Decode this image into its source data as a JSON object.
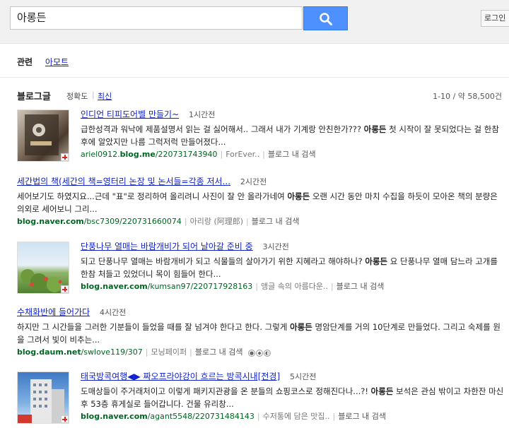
{
  "search": {
    "query": "아롱든",
    "login_label": "로그인"
  },
  "related": {
    "label": "관련",
    "items": [
      "아모트"
    ]
  },
  "section": {
    "title": "블로그글",
    "sort_accuracy": "정확도",
    "sort_latest": "최신",
    "count": "1-10 / 약 58,500건"
  },
  "results": [
    {
      "title": "인디언 티피도어벨 만들기~",
      "time": "1시간전",
      "snippet_pre": "급한성격과 워낙에 제품설명서 읽는 걸 싫어해서.. 그래서 내가 기계랑 안친한가??? ",
      "snippet_bold": "아롱든",
      "snippet_post": " 첫 시작이 잘 못되었다는 걸 한참 후에 알았지만 나름 그럭저럭 만들어졌다...",
      "url_pre": "ariel0912.",
      "url_bold": "blog.me",
      "url_post": "/220731743940",
      "author": "ForEver..",
      "action": "블로그 내 검색"
    },
    {
      "title": "세간법의 책(세간의 책=영터리 논장 및 논서들=각종 저서...",
      "time": "2시간전",
      "snippet_pre": "세어보기도 하였지요...근데 \"표\"로 정리하여 올리려니 사진이 잘 안 올라가네여 ",
      "snippet_bold": "아롱든",
      "snippet_post": "  오랜 시간 동안 마치 수집을 하듯이 모아온 책의 분량은 의외로 세어보니 그리...",
      "url_pre": "",
      "url_bold": "blog.naver.com",
      "url_post": "/bsc7309/220731660074",
      "author": "아리랑 (阿理郎)",
      "action": "블로그 내 검색"
    },
    {
      "title": "단풍나무 열매는 바람개비가 되어 날아갈 준비 중",
      "time": "3시간전",
      "snippet_pre": "되고 단풍나무 열매는 바람개비가 되고 식물들의 살아가기 위한 지혜라고 해야하나? ",
      "snippet_bold": "아롱든",
      "snippet_post": " 요 단풍나무 열매 담느라 고개를 한참 처들고 있었더니 목이 힘들어 한다...",
      "url_pre": "",
      "url_bold": "blog.naver.com",
      "url_post": "/kumsan97/220717928163",
      "author": "앵글 속의 아름다운..",
      "action": "블로그 내 검색"
    },
    {
      "title": "수채화반에 들어가다",
      "time": "4시간전",
      "snippet_pre": "하지만 그 시간들을 그러한 기분들이 들었을 때를 잘 넘겨야 한다고 한다. 그렇게 ",
      "snippet_bold": "아롱든",
      "snippet_post": " 명암단계를 거의 10단계로 만들었다. 그리고 숙제를 원을 그려서 빛이 비추는...",
      "url_pre": "",
      "url_bold": "blog.daum.net",
      "url_post": "/swlove119/307",
      "author": "모닝페이퍼",
      "action": "블로그 내 검색"
    },
    {
      "title": "태국방콕여행◀▶ 짜오프라야강이 흐르는 방콕시내[전경]",
      "time": "5시간전",
      "snippet_pre": "도매상들이 주거래처이고 이렇게 패키지관광을 온 분들의 쇼핑코스로 정해진다나...?! ",
      "snippet_bold": "아롱든",
      "snippet_post": " 보석은 관심 밖이고 차한잔 마신후 53층 휴게실로 들어갑니다. 건물 유리창...",
      "url_pre": "",
      "url_bold": "blog.naver.com",
      "url_post": "/agant5548/220731484143",
      "author": "수저통에 담은 맛집..",
      "action": "블로그 내 검색"
    }
  ]
}
